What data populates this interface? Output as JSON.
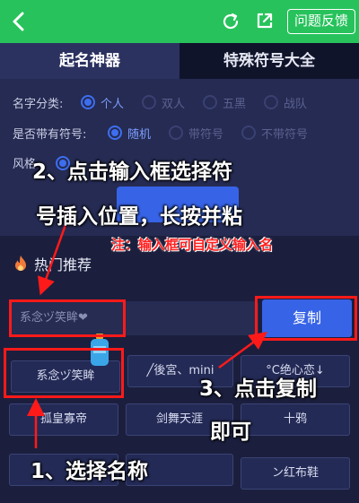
{
  "header": {
    "back_icon": "chevron-left-icon",
    "refresh_icon": "refresh-icon",
    "share_icon": "share-icon",
    "feedback_label": "问题反馈"
  },
  "tabs": [
    {
      "label": "起名神器",
      "active": true
    },
    {
      "label": "特殊符号大全",
      "active": false
    }
  ],
  "options": {
    "category": {
      "label": "名字分类:",
      "choices": [
        "个人",
        "双人",
        "五黑",
        "战队"
      ],
      "selected": "个人"
    },
    "symbol": {
      "label": "是否带有符号:",
      "choices": [
        "随机",
        "带符号",
        "不带符号"
      ],
      "selected": "随机"
    },
    "style": {
      "label": "风格"
    }
  },
  "hot": {
    "title": "热门推荐",
    "input_value": "系念ヅ笑眸❤",
    "copy_label": "复制",
    "names": [
      "系念ヅ笑眸",
      "╱後宮、mini",
      "°C绝心恋↓",
      "孤皇寡帝",
      "剑舞天涯",
      "十鸦",
      "",
      "ン红布鞋"
    ]
  },
  "annotations": {
    "step2_line1": "2、点击输入框选择符",
    "step2_line2": "号插入位置，长按并粘",
    "note": "注：输入框可自定义输入名",
    "step3_line1": "3、点击复制",
    "step3_line2": "即可",
    "step1": "1、选择名称"
  },
  "colors": {
    "header_green": "#27c25c",
    "accent_blue": "#3763e6",
    "annotation_red": "#ff1a1a"
  }
}
